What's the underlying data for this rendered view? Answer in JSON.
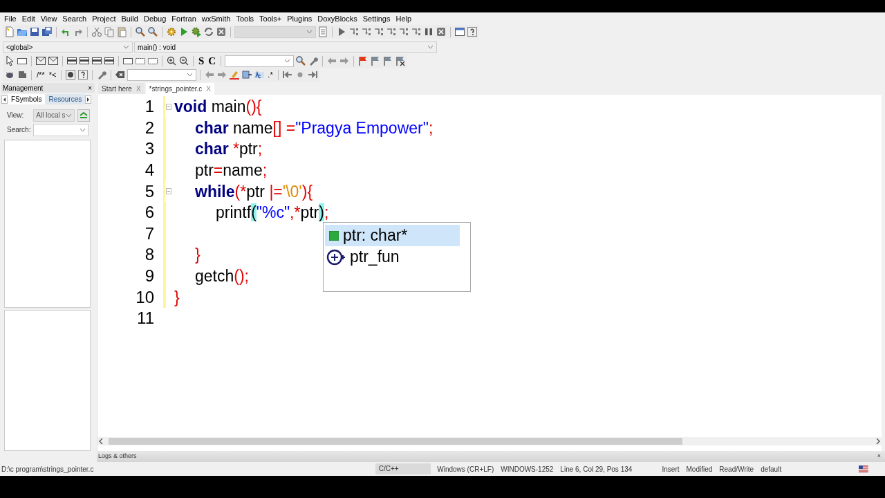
{
  "menu": [
    "File",
    "Edit",
    "View",
    "Search",
    "Project",
    "Build",
    "Debug",
    "Fortran",
    "wxSmith",
    "Tools",
    "Tools+",
    "Plugins",
    "DoxyBlocks",
    "Settings",
    "Help"
  ],
  "toolbars": [
    {
      "items": [
        {
          "kind": "icon"
        },
        {
          "kind": "icon"
        },
        {
          "kind": "icon"
        },
        {
          "kind": "icon"
        },
        {
          "kind": "separator"
        },
        {
          "kind": "icon"
        },
        {
          "kind": "icon"
        },
        {
          "kind": "separator"
        },
        {
          "kind": "icon"
        },
        {
          "kind": "icon"
        },
        {
          "kind": "icon"
        },
        {
          "kind": "separator"
        },
        {
          "kind": "icon"
        },
        {
          "kind": "icon"
        },
        {
          "kind": "separator"
        },
        {
          "kind": "icon"
        },
        {
          "kind": "icon"
        },
        {
          "kind": "icon"
        },
        {
          "kind": "icon"
        },
        {
          "kind": "icon"
        },
        {
          "kind": "separator"
        },
        {
          "kind": "combo",
          "disabled": true
        },
        {
          "kind": "icon"
        },
        {
          "kind": "separator"
        },
        {
          "kind": "icon"
        },
        {
          "kind": "icon"
        },
        {
          "kind": "icon"
        },
        {
          "kind": "icon"
        },
        {
          "kind": "icon"
        },
        {
          "kind": "icon"
        },
        {
          "kind": "icon"
        },
        {
          "kind": "icon"
        },
        {
          "kind": "icon"
        },
        {
          "kind": "separator"
        },
        {
          "kind": "icon"
        },
        {
          "kind": "icon"
        }
      ]
    },
    {
      "items": [
        {
          "kind": "icon"
        },
        {
          "kind": "icon"
        },
        {
          "kind": "separator"
        },
        {
          "kind": "icon"
        },
        {
          "kind": "icon"
        },
        {
          "kind": "separator"
        },
        {
          "kind": "icon"
        },
        {
          "kind": "icon"
        },
        {
          "kind": "icon"
        },
        {
          "kind": "icon"
        },
        {
          "kind": "separator"
        },
        {
          "kind": "icon"
        },
        {
          "kind": "icon"
        },
        {
          "kind": "icon"
        },
        {
          "kind": "separator"
        },
        {
          "kind": "icon"
        },
        {
          "kind": "icon"
        },
        {
          "kind": "separator"
        },
        {
          "kind": "text",
          "label": "S"
        },
        {
          "kind": "text",
          "label": "C"
        },
        {
          "kind": "separator"
        },
        {
          "kind": "combo",
          "disabled": false
        },
        {
          "kind": "icon"
        },
        {
          "kind": "icon"
        },
        {
          "kind": "separator"
        },
        {
          "kind": "icon"
        },
        {
          "kind": "icon"
        },
        {
          "kind": "separator"
        },
        {
          "kind": "icon"
        },
        {
          "kind": "icon"
        },
        {
          "kind": "icon"
        },
        {
          "kind": "icon"
        }
      ]
    },
    {
      "items": [
        {
          "kind": "icon"
        },
        {
          "kind": "icon"
        },
        {
          "kind": "separator"
        },
        {
          "kind": "text",
          "label": "/**"
        },
        {
          "kind": "text",
          "label": "*<"
        },
        {
          "kind": "separator"
        },
        {
          "kind": "icon"
        },
        {
          "kind": "icon"
        },
        {
          "kind": "separator"
        },
        {
          "kind": "icon"
        },
        {
          "kind": "separator"
        },
        {
          "kind": "icon"
        },
        {
          "kind": "combo",
          "disabled": false
        },
        {
          "kind": "separator"
        },
        {
          "kind": "icon"
        },
        {
          "kind": "icon"
        },
        {
          "kind": "icon"
        },
        {
          "kind": "icon"
        },
        {
          "kind": "icon"
        },
        {
          "kind": "text",
          "label": ".*"
        },
        {
          "kind": "separator"
        },
        {
          "kind": "icon"
        },
        {
          "kind": "icon"
        },
        {
          "kind": "icon"
        }
      ]
    }
  ],
  "scope": {
    "left": "<global>",
    "right": "main() : void"
  },
  "management": {
    "title": "Management",
    "close": "×",
    "tabs": [
      {
        "label": "FSymbols",
        "selected": true
      },
      {
        "label": "Resources",
        "selected": false
      }
    ],
    "view_label": "View:",
    "view_value": "All local s",
    "search_label": "Search:"
  },
  "editor_tabs": [
    {
      "label": "Start here",
      "close": "X",
      "selected": false
    },
    {
      "label": "*strings_pointer.c",
      "close": "X",
      "selected": true
    }
  ],
  "lines": [
    {
      "number": "1",
      "changed": true,
      "fold": true,
      "tokens": [
        {
          "text": "void",
          "kind": "keyword"
        },
        {
          "text": " main",
          "kind": "ident"
        },
        {
          "text": "(){",
          "kind": "op"
        }
      ]
    },
    {
      "number": "2",
      "changed": true,
      "fold": false,
      "tokens": [
        {
          "text": "\tchar",
          "kind": "keyword"
        },
        {
          "text": " name",
          "kind": "ident"
        },
        {
          "text": "[]",
          "kind": "op"
        },
        {
          "text": " =",
          "kind": "op"
        },
        {
          "text": "\"Pragya Empower\"",
          "kind": "string"
        },
        {
          "text": ";",
          "kind": "op"
        }
      ]
    },
    {
      "number": "3",
      "changed": true,
      "fold": false,
      "tokens": [
        {
          "text": "\tchar",
          "kind": "keyword"
        },
        {
          "text": " *",
          "kind": "op"
        },
        {
          "text": "ptr",
          "kind": "ident"
        },
        {
          "text": ";",
          "kind": "op"
        }
      ]
    },
    {
      "number": "4",
      "changed": true,
      "fold": false,
      "tokens": [
        {
          "text": "\tptr",
          "kind": "ident"
        },
        {
          "text": "=",
          "kind": "op"
        },
        {
          "text": "name",
          "kind": "ident"
        },
        {
          "text": ";",
          "kind": "op"
        }
      ]
    },
    {
      "number": "5",
      "changed": true,
      "fold": true,
      "tokens": [
        {
          "text": "\twhile",
          "kind": "keyword"
        },
        {
          "text": "(*",
          "kind": "op"
        },
        {
          "text": "ptr ",
          "kind": "ident"
        },
        {
          "text": "|=",
          "kind": "op"
        },
        {
          "text": "'\\0'",
          "kind": "char"
        },
        {
          "text": "){",
          "kind": "op"
        }
      ]
    },
    {
      "number": "6",
      "changed": true,
      "fold": false,
      "tokens": [
        {
          "text": "\t\tprintf",
          "kind": "ident"
        },
        {
          "text": "(",
          "kind": "brace_match"
        },
        {
          "text": "\"%c\"",
          "kind": "string"
        },
        {
          "text": ",",
          "kind": "op"
        },
        {
          "text": "*",
          "kind": "op"
        },
        {
          "text": "ptr",
          "kind": "ident"
        },
        {
          "text": ")",
          "kind": "brace_match"
        },
        {
          "text": ";",
          "kind": "op"
        }
      ]
    },
    {
      "number": "7",
      "changed": true,
      "fold": false
    },
    {
      "number": "8",
      "changed": true,
      "fold": false,
      "tokens": [
        {
          "text": "\t}",
          "kind": "op"
        }
      ]
    },
    {
      "number": "9",
      "changed": true,
      "fold": false,
      "tokens": [
        {
          "text": "\tgetch",
          "kind": "ident"
        },
        {
          "text": "();",
          "kind": "op"
        }
      ]
    },
    {
      "number": "10",
      "changed": true,
      "fold": false,
      "tokens": [
        {
          "text": "}",
          "kind": "op"
        }
      ]
    },
    {
      "number": "11",
      "changed": false,
      "fold": false
    }
  ],
  "autocomplete": [
    {
      "label": "ptr: char*",
      "kind": "variable",
      "selected": true
    },
    {
      "label": "ptr_fun",
      "kind": "function",
      "selected": false
    }
  ],
  "logs": {
    "title": "Logs & others",
    "close": "×"
  },
  "status_bar": [
    {
      "text": "D:\\c program\\strings_pointer.c",
      "kind": "path"
    },
    {
      "text": "C/C++",
      "kind": "shaded"
    },
    {
      "text": "Windows (CR+LF)",
      "kind": "plain"
    },
    {
      "text": "WINDOWS-1252",
      "kind": "plain"
    },
    {
      "text": "Line 6, Col 29, Pos 134",
      "kind": "wide"
    },
    {
      "text": "Insert",
      "kind": "plain"
    },
    {
      "text": "Modified",
      "kind": "plain"
    },
    {
      "text": "Read/Write",
      "kind": "plain"
    },
    {
      "text": "default",
      "kind": "wide"
    }
  ]
}
